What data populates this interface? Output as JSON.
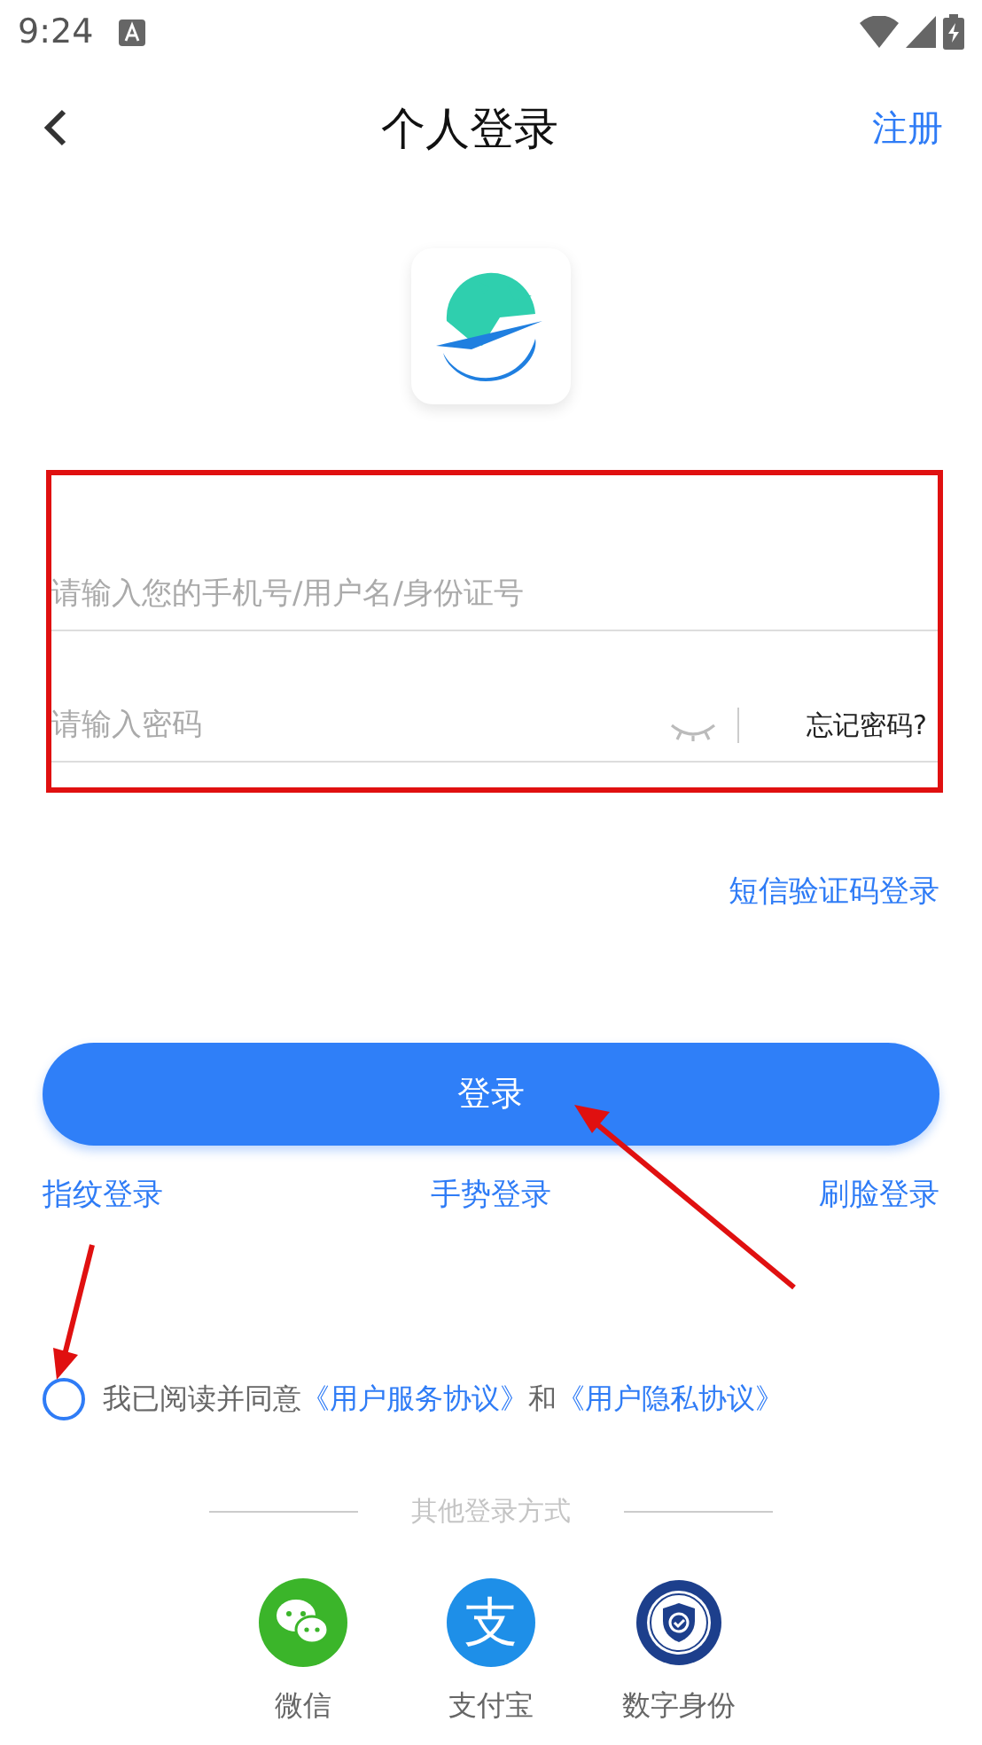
{
  "status_bar": {
    "time": "9:24"
  },
  "header": {
    "title": "个人登录",
    "action": "注册"
  },
  "form": {
    "highlighted": true,
    "fields": [
      {
        "kind": "text",
        "placeholder": "请输入您的手机号/用户名/身份证号"
      },
      {
        "kind": "password",
        "placeholder": "请输入密码",
        "forgot": "忘记密码?"
      }
    ]
  },
  "sms_login": "短信验证码登录",
  "login_button": "登录",
  "alt_logins": [
    "指纹登录",
    "手势登录",
    "刷脸登录"
  ],
  "agreement": {
    "checked": false,
    "text": "我已阅读并同意",
    "link_1": "《用户服务协议》",
    "joiner": "和",
    "link_2": "《用户隐私协议》"
  },
  "other_methods": {
    "title": "其他登录方式",
    "items": [
      {
        "kind": "wechat",
        "label": "微信"
      },
      {
        "kind": "alipay",
        "label": "支付宝",
        "glyph": "支"
      },
      {
        "kind": "digital-id",
        "label": "数字身份"
      }
    ]
  },
  "annotation_arrows_shown": true
}
